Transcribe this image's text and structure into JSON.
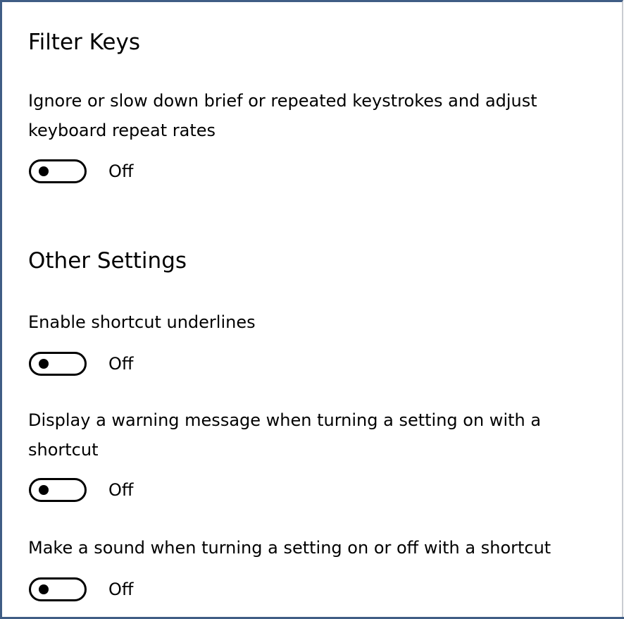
{
  "filter_keys": {
    "title": "Filter Keys",
    "description": "Ignore or slow down brief or repeated keystrokes and adjust keyboard repeat rates",
    "toggle_state": "Off"
  },
  "other_settings": {
    "title": "Other Settings",
    "items": [
      {
        "label": "Enable shortcut underlines",
        "toggle_state": "Off"
      },
      {
        "label": "Display a warning message when turning a setting on with a shortcut",
        "toggle_state": "Off"
      },
      {
        "label": "Make a sound when turning a setting on or off with a shortcut",
        "toggle_state": "Off"
      }
    ]
  },
  "colors": {
    "frame_border": "#3f5d85",
    "toggle_off": "#000000",
    "background": "#ffffff"
  }
}
